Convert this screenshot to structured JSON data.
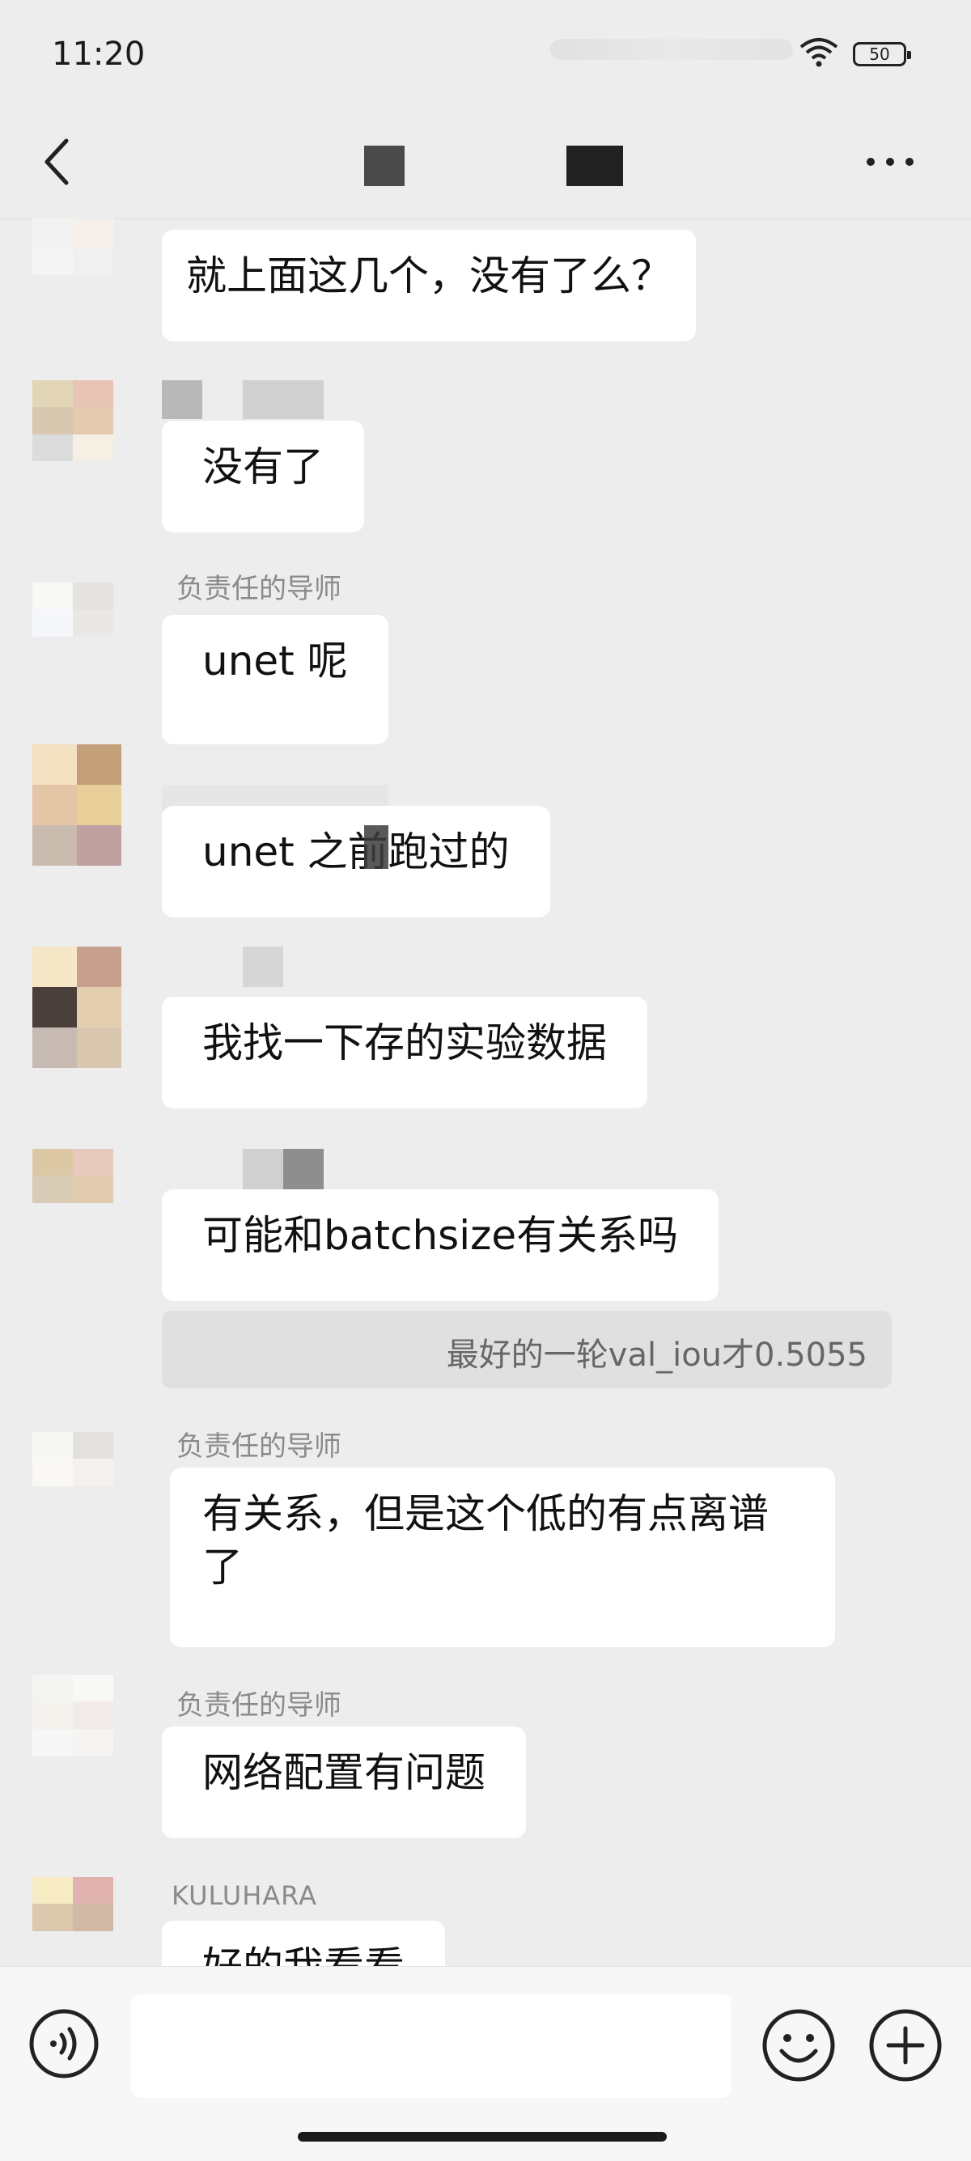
{
  "status_bar": {
    "time": "11:20",
    "battery": "50"
  },
  "header": {
    "title": "",
    "back_icon": "chevron-left-icon",
    "more_icon": "more-dots-icon"
  },
  "messages": [
    {
      "sender": "",
      "text": "就上面这几个，没有了么？"
    },
    {
      "sender": "",
      "text": "没有了"
    },
    {
      "sender": "负责任的导师",
      "text": "unet 呢"
    },
    {
      "sender": "",
      "text": "unet 之前跑过的"
    },
    {
      "sender": "",
      "text": "我找一下存的实验数据"
    },
    {
      "sender": "",
      "text": "可能和batchsize有关系吗",
      "quote": "最好的一轮val_iou才0.5055"
    },
    {
      "sender": "负责任的导师",
      "text": "有关系，但是这个低的有点离谱了"
    },
    {
      "sender": "负责任的导师",
      "text": "网络配置有问题"
    },
    {
      "sender": "KULUHARA",
      "text": "好的我看看"
    }
  ],
  "input_bar": {
    "placeholder": "",
    "voice_icon": "voice-icon",
    "emoji_icon": "emoji-icon",
    "plus_icon": "plus-icon"
  }
}
